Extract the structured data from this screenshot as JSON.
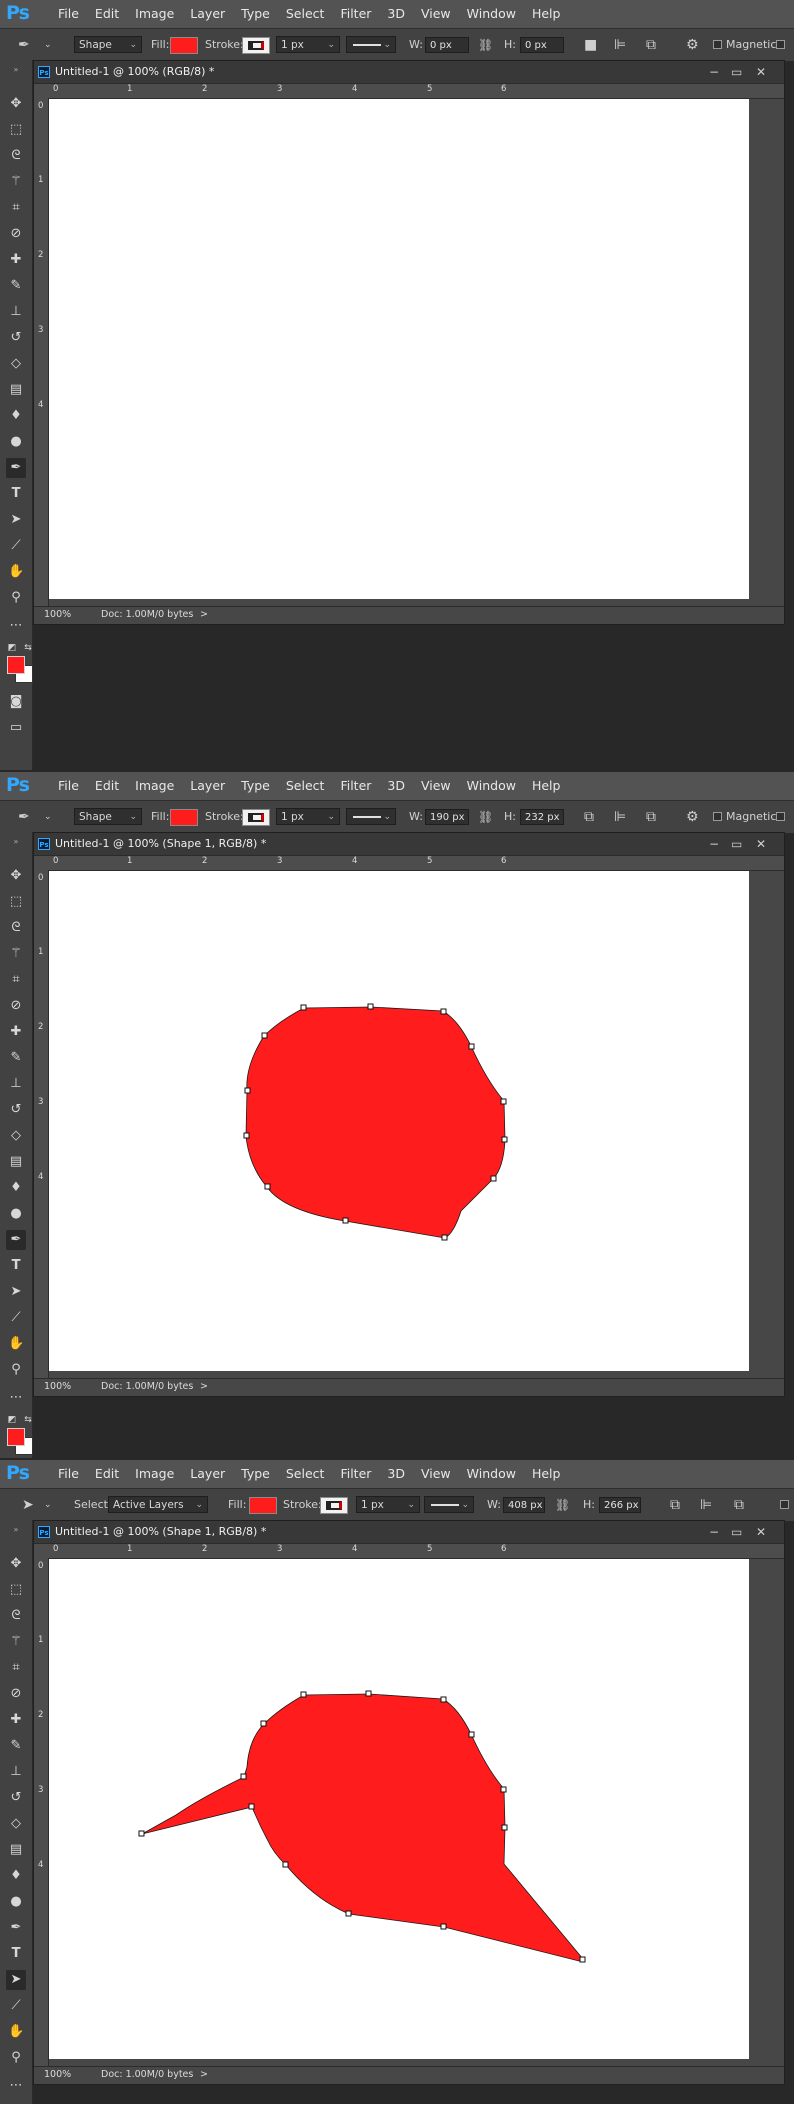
{
  "app": {
    "logo": "Ps"
  },
  "menu": [
    "File",
    "Edit",
    "Image",
    "Layer",
    "Type",
    "Select",
    "Filter",
    "3D",
    "View",
    "Window",
    "Help"
  ],
  "colors": {
    "fill": "#ff1c1c",
    "background": "#ffffff",
    "ps_blue": "#31a8ff"
  },
  "ruler": {
    "top_labels": [
      "0",
      "1",
      "2",
      "3",
      "4",
      "5",
      "6"
    ],
    "left_labels": [
      "0",
      "1",
      "2",
      "3",
      "4"
    ]
  },
  "options": {
    "mode": "Shape",
    "fill_label": "Fill:",
    "stroke_label": "Stroke:",
    "stroke_width": "1 px",
    "w_label": "W:",
    "h_label": "H:",
    "magnetic_label": "Magnetic",
    "select_label": "Select:",
    "select_value": "Active Layers"
  },
  "screens": [
    {
      "doc_title": "Untitled-1 @ 100% (RGB/8) *",
      "w_value": "0 px",
      "h_value": "0 px",
      "zoom": "100%",
      "doc_info": "Doc: 1.00M/0 bytes",
      "arrow": ">"
    },
    {
      "doc_title": "Untitled-1 @ 100% (Shape 1, RGB/8) *",
      "w_value": "190 px",
      "h_value": "232 px",
      "zoom": "100%",
      "doc_info": "Doc: 1.00M/0 bytes",
      "arrow": ">"
    },
    {
      "doc_title": "Untitled-1 @ 100% (Shape 1, RGB/8) *",
      "w_value": "408 px",
      "h_value": "266 px",
      "zoom": "100%",
      "doc_info": "Doc: 1.00M/0 bytes",
      "arrow": ">"
    }
  ],
  "tools": [
    "move-icon",
    "marquee-icon",
    "lasso-icon",
    "magic-wand-icon",
    "crop-icon",
    "eyedropper-icon",
    "healing-brush-icon",
    "brush-icon",
    "clone-stamp-icon",
    "history-brush-icon",
    "eraser-icon",
    "gradient-icon",
    "blur-icon",
    "dodge-icon",
    "pen-icon",
    "type-icon",
    "path-selection-icon",
    "line-icon",
    "hand-icon",
    "zoom-icon",
    "more-tools-icon"
  ]
}
